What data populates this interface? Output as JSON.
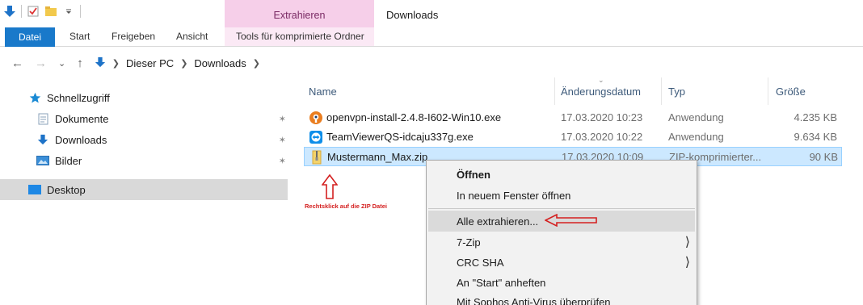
{
  "window": {
    "title": "Downloads"
  },
  "ribbon": {
    "context_tab": "Extrahieren",
    "tabs": [
      "Datei",
      "Start",
      "Freigeben",
      "Ansicht",
      "Tools für komprimierte Ordner"
    ]
  },
  "address": {
    "crumbs": [
      "Dieser PC",
      "Downloads"
    ]
  },
  "sidebar": {
    "items": [
      {
        "label": "Schnellzugriff",
        "icon": "star-icon",
        "color": "#1a8ad4"
      },
      {
        "label": "Dokumente",
        "icon": "documents-icon",
        "pinned": true
      },
      {
        "label": "Downloads",
        "icon": "download-arrow-icon",
        "pinned": true
      },
      {
        "label": "Bilder",
        "icon": "pictures-icon",
        "pinned": true
      },
      {
        "label": "Desktop",
        "icon": "desktop-icon",
        "selected": true
      }
    ]
  },
  "columns": {
    "name": "Name",
    "date": "Änderungsdatum",
    "type": "Typ",
    "size": "Größe"
  },
  "files": [
    {
      "name": "openvpn-install-2.4.8-I602-Win10.exe",
      "date": "17.03.2020 10:23",
      "type": "Anwendung",
      "size": "4.235 KB",
      "icon": "openvpn-icon"
    },
    {
      "name": "TeamViewerQS-idcaju337g.exe",
      "date": "17.03.2020 10:22",
      "type": "Anwendung",
      "size": "9.634 KB",
      "icon": "teamviewer-icon"
    },
    {
      "name": "Mustermann_Max.zip",
      "date": "17.03.2020 10:09",
      "type": "ZIP-komprimierter...",
      "size": "90 KB",
      "icon": "zip-folder-icon",
      "selected": true
    }
  ],
  "annotation": {
    "text": "Rechtsklick auf die ZIP Datei",
    "color": "#d42020"
  },
  "context_menu": {
    "items": [
      {
        "label": "Öffnen",
        "bold": true
      },
      {
        "label": "In neuem Fenster öffnen"
      },
      {
        "label": "Alle extrahieren...",
        "highlighted": true
      },
      {
        "label": "7-Zip",
        "submenu": true
      },
      {
        "label": "CRC SHA",
        "submenu": true
      },
      {
        "label": "An \"Start\" anheften"
      },
      {
        "label": "Mit Sophos Anti-Virus überprüfen"
      }
    ]
  }
}
